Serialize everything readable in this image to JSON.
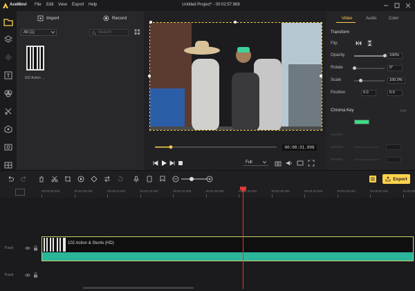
{
  "app": {
    "name": "AceMovi",
    "window_title": "Untitled Project* - 00:02:57.969",
    "menu": [
      "File",
      "Edit",
      "View",
      "Export",
      "Help"
    ]
  },
  "media": {
    "import_label": "Import",
    "record_label": "Record",
    "filter_value": "All (1)",
    "search_placeholder": "Search",
    "items": [
      {
        "label": "102 Action ..."
      }
    ]
  },
  "preview": {
    "time": "00:00:31.906",
    "quality": "Full",
    "progress": 0.13
  },
  "props": {
    "tabs": [
      "Video",
      "Audio",
      "Color"
    ],
    "section_transform": "Transform",
    "flip_label": "Flip",
    "opacity_label": "Opacity",
    "opacity_value": "100%",
    "opacity": 1.0,
    "rotate_label": "Rotate",
    "rotate_value": "0°",
    "rotate": 0.0,
    "scale_label": "Scale",
    "scale_value": "100.0%",
    "scale": 0.22,
    "position_label": "Position",
    "pos_x": "0.0",
    "pos_y": "0.0",
    "section_chroma": "Chroma Key",
    "chroma_color": "#3ddc84"
  },
  "timeline": {
    "export_label": "Export",
    "ruler": [
      "00:00:00.000",
      "00:00:05.000",
      "00:00:10.000",
      "00:00:15.000",
      "00:00:20.000",
      "00:00:25.000",
      "00:00:30.000",
      "00:00:35.000",
      "00:00:40.000",
      "00:00:45.000",
      "00:00:50.000",
      "00:00:55.000"
    ],
    "tracks": [
      "Track",
      "Track"
    ],
    "clip_name": "102 Action & Stunts (HD)"
  },
  "colors": {
    "accent": "#ffd24d",
    "playhead": "#e53935",
    "clip_audio": "#2bb59a"
  }
}
